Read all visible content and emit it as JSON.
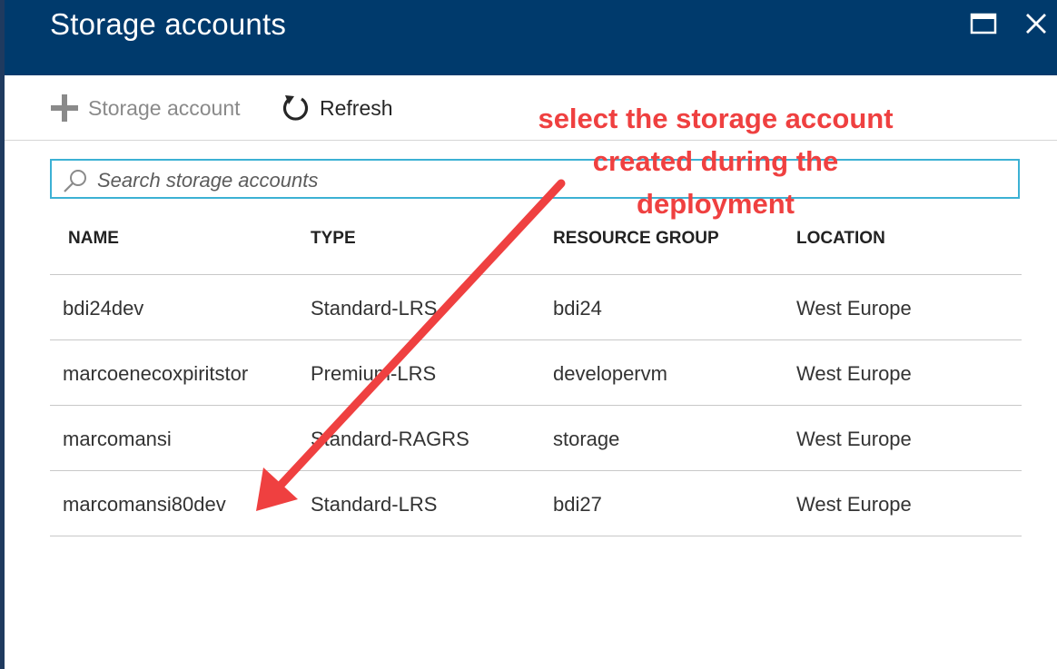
{
  "window": {
    "title": "Storage accounts",
    "maximize_icon": "maximize-icon",
    "close_icon": "close-icon"
  },
  "toolbar": {
    "add_label": "Storage account",
    "refresh_label": "Refresh"
  },
  "search": {
    "placeholder": "Search storage accounts",
    "value": ""
  },
  "table": {
    "columns": [
      "NAME",
      "TYPE",
      "RESOURCE GROUP",
      "LOCATION"
    ],
    "rows": [
      [
        "bdi24dev",
        "Standard-LRS",
        "bdi24",
        "West Europe"
      ],
      [
        "marcoenecoxpiritstor",
        "Premium-LRS",
        "developervm",
        "West Europe"
      ],
      [
        "marcomansi",
        "Standard-RAGRS",
        "storage",
        "West Europe"
      ],
      [
        "marcomansi80dev",
        "Standard-LRS",
        "bdi27",
        "West Europe"
      ]
    ]
  },
  "annotation": {
    "lines": [
      "select the storage account",
      "created during the",
      "deployment"
    ],
    "color": "#ef4040"
  },
  "colors": {
    "header_bg": "#003a6c",
    "search_border": "#3cb1d4"
  }
}
